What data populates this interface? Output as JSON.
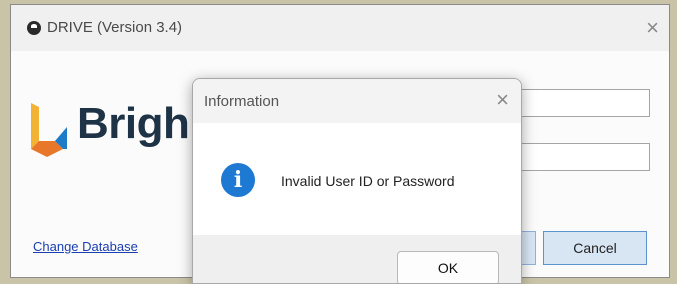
{
  "main_window": {
    "title": "DRIVE (Version 3.4)",
    "close_glyph": "×",
    "brand_text": "Brigh",
    "change_database_link": "Change Database",
    "cancel_button": "Cancel"
  },
  "dialog": {
    "title": "Information",
    "close_glyph": "×",
    "icon": "info-icon",
    "icon_glyph": "i",
    "message": "Invalid User ID or Password",
    "ok_button": "OK"
  },
  "colors": {
    "logo_yellow": "#f2b233",
    "logo_orange": "#e8772a",
    "logo_blue": "#1e7bc8",
    "brand_text": "#1e3346",
    "info_icon": "#1e79d2",
    "link": "#1a3fb0"
  }
}
